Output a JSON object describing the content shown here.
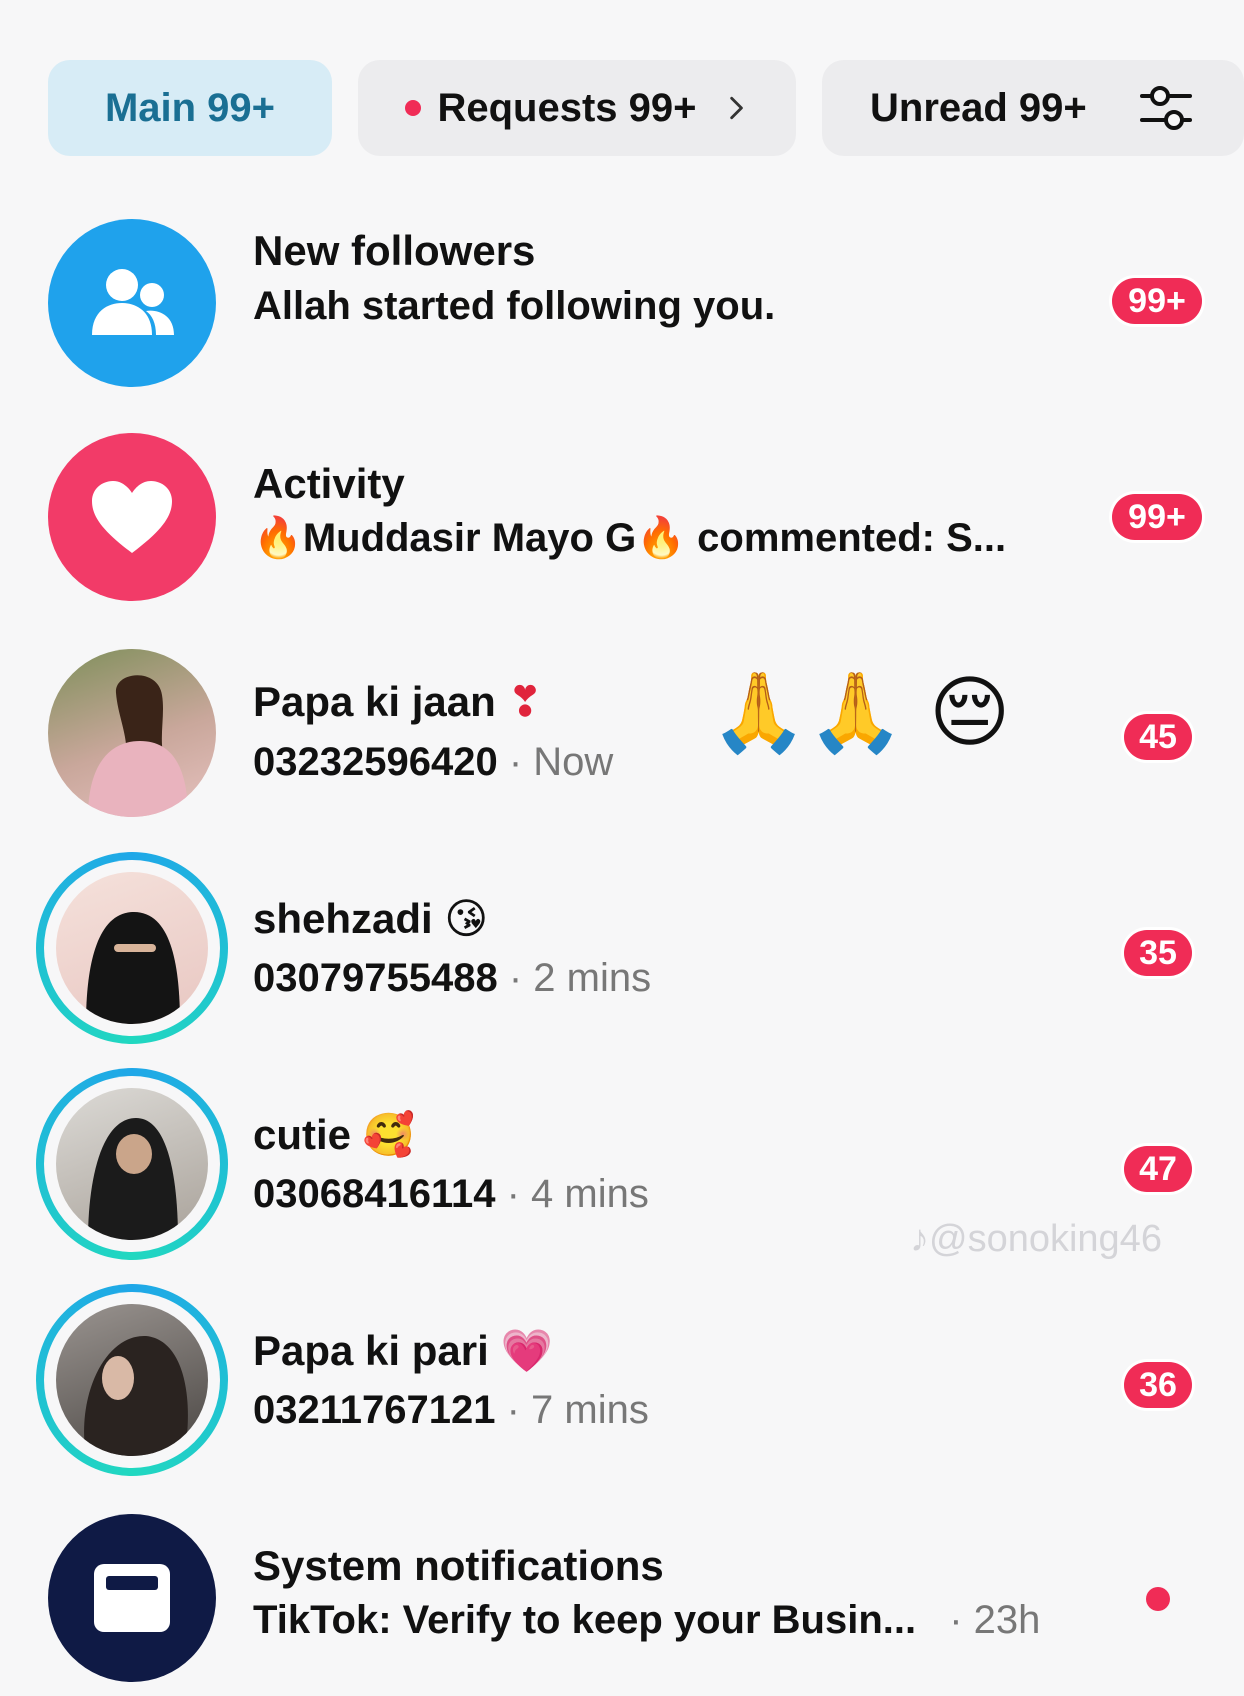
{
  "tabs": {
    "main": "Main 99+",
    "requests": "Requests 99+",
    "unread": "Unread 99+"
  },
  "rows": [
    {
      "title": "New followers",
      "subtitle": "Allah started following you.",
      "badge": "99+",
      "icon": "followers-icon",
      "color": "#1fa2ec"
    },
    {
      "title": "Activity",
      "subtitle_name": "Muddasir Mayo G",
      "subtitle_rest": "commented: S...",
      "badge": "99+",
      "icon": "heart-icon",
      "color": "#f23b68"
    },
    {
      "title": "Papa ki jaan",
      "title_emoji": "❣",
      "extra_emoji": "🙏🙏 😔",
      "phone": "03232596420",
      "time": "· Now",
      "badge": "45"
    },
    {
      "title": "shehzadi",
      "title_emoji": "😘",
      "phone": "03079755488",
      "time": "· 2 mins",
      "badge": "35"
    },
    {
      "title": "cutie",
      "title_emoji": "🥰",
      "phone": "03068416114",
      "time": "· 4 mins",
      "badge": "47"
    },
    {
      "title": "Papa ki pari",
      "title_emoji": "💗",
      "phone": "03211767121",
      "time": "· 7 mins",
      "badge": "36"
    },
    {
      "title": "System notifications",
      "subtitle": "TikTok: Verify to keep your Busin...",
      "time": "· 23h",
      "icon": "inbox-icon",
      "color": "#0f1a45"
    }
  ],
  "watermark": "@sonoking46",
  "fire_emoji": "🔥"
}
